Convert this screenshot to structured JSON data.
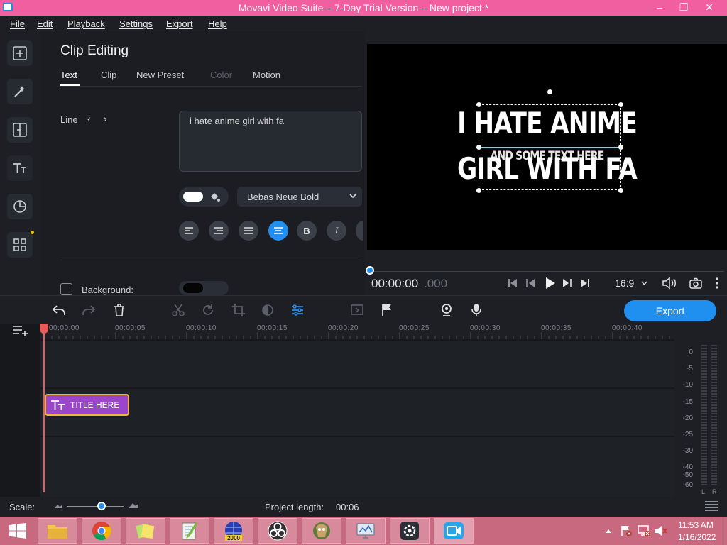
{
  "window": {
    "title": "Movavi Video Suite – 7-Day Trial Version – New project *",
    "minimize": "–",
    "maximize": "❐",
    "close": "✕"
  },
  "menu": [
    "File",
    "Edit",
    "Playback",
    "Settings",
    "Export",
    "Help"
  ],
  "panel": {
    "title": "Clip Editing",
    "tabs": [
      "Text",
      "Clip",
      "New Preset",
      "Color",
      "Motion"
    ],
    "active_tab": "Text",
    "line_label": "Line",
    "text_value": "i hate anime girl with fa",
    "font": "Bebas Neue Bold",
    "background_label": "Background:"
  },
  "preview": {
    "line1": "I HATE ANIME",
    "line2": "GIRL WITH FA",
    "overlay": "AND SOME TEXT HERE"
  },
  "playback": {
    "time_main": "00:00:00",
    "time_frac": ".000",
    "aspect": "16:9"
  },
  "toolbar": {
    "export_label": "Export"
  },
  "timeline": {
    "ticks": [
      "00:00:00",
      "00:00:05",
      "00:00:10",
      "00:00:15",
      "00:00:20",
      "00:00:25",
      "00:00:30",
      "00:00:35",
      "00:00:40"
    ],
    "clip_label": "TITLE HERE"
  },
  "meter": {
    "labels": [
      "0",
      "-5",
      "-10",
      "-15",
      "-20",
      "-25",
      "-30",
      "-40",
      "-50",
      "-60"
    ],
    "left": "L",
    "right": "R"
  },
  "status": {
    "scale_label": "Scale:",
    "project_length_label": "Project length:",
    "project_length_value": "00:06"
  },
  "taskbar": {
    "time": "11:53 AM",
    "date": "1/16/2022"
  },
  "colors": {
    "accent": "#1f8ff0",
    "title_bar": "#f25fa0",
    "taskbar": "#c8697f",
    "clip": "#9b45c9",
    "playhead": "#e85b5b"
  }
}
